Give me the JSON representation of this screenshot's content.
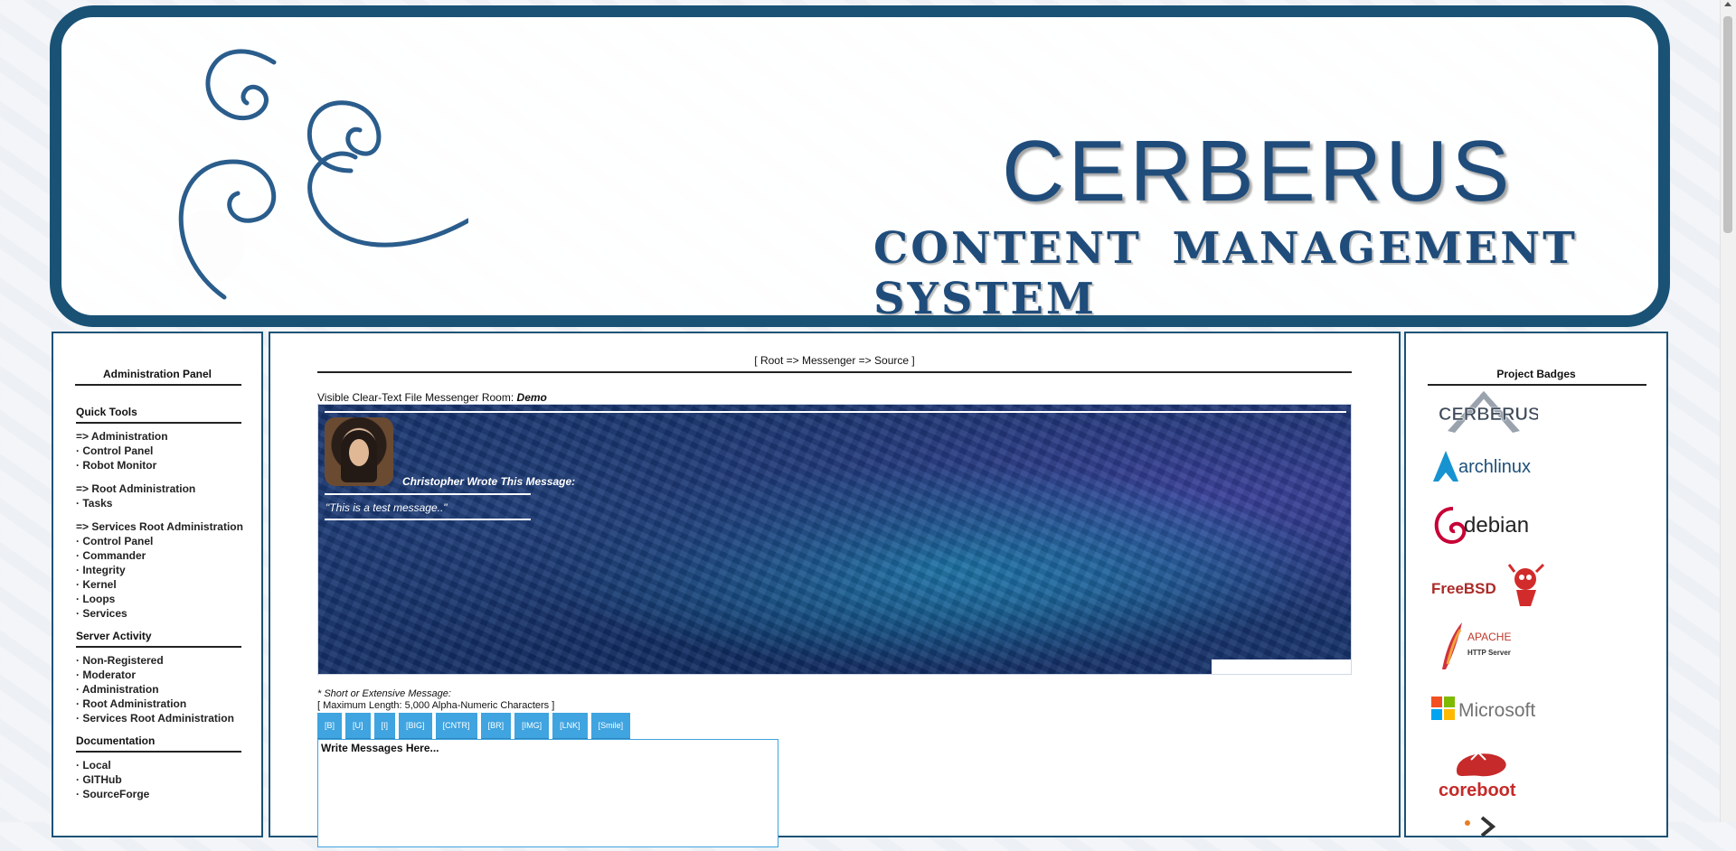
{
  "banner": {
    "title": "CERBERUS",
    "subtitle": "CONTENT MANAGEMENT SYSTEM"
  },
  "left_panel": {
    "heading": "Administration Panel",
    "sections": [
      {
        "title": "Quick Tools",
        "groups": [
          {
            "items": [
              "=> Administration",
              "· Control Panel",
              "· Robot Monitor"
            ]
          },
          {
            "items": [
              "=> Root Administration",
              "· Tasks"
            ]
          },
          {
            "items": [
              "=> Services Root Administration",
              "· Control Panel",
              "· Commander",
              "· Integrity",
              "· Kernel",
              "· Loops",
              "· Services"
            ]
          }
        ]
      },
      {
        "title": "Server Activity",
        "groups": [
          {
            "items": [
              "· Non-Registered",
              "· Moderator",
              "· Administration",
              "· Root Administration",
              "· Services Root Administration"
            ]
          }
        ]
      },
      {
        "title": "Documentation",
        "groups": [
          {
            "items": [
              "· Local",
              "· GITHub",
              "· SourceForge"
            ]
          }
        ]
      }
    ]
  },
  "center": {
    "breadcrumb": "[ Root => Messenger => Source ]",
    "room_label": "Visible Clear-Text File Messenger Room:",
    "room_name": "Demo",
    "message": {
      "author_line": "Christopher Wrote This Message:",
      "text": "\"This is a test message..\""
    },
    "message_note": "* Short or Extensive Message:",
    "max_length_note": "[ Maximum Length: 5,000 Alpha-Numeric Characters ]",
    "toolbar": [
      "[B]",
      "[U]",
      "[I]",
      "[BIG]",
      "[CNTR]",
      "[BR]",
      "[IMG]",
      "[LNK]",
      "[Smile]"
    ],
    "textarea_placeholder": "Write Messages Here..."
  },
  "right_panel": {
    "heading": "Project Badges",
    "badges": {
      "cerberus": "CERBERUS",
      "arch": "archlinux",
      "debian": "debian",
      "freebsd": "FreeBSD",
      "apache_top": "APACHE",
      "apache_bottom": "HTTP Server",
      "microsoft": "Microsoft",
      "coreboot": "coreboot"
    }
  },
  "colors": {
    "border": "#1a5276",
    "accent_button": "#3fa4e0",
    "title_text": "#1f4c7a"
  }
}
